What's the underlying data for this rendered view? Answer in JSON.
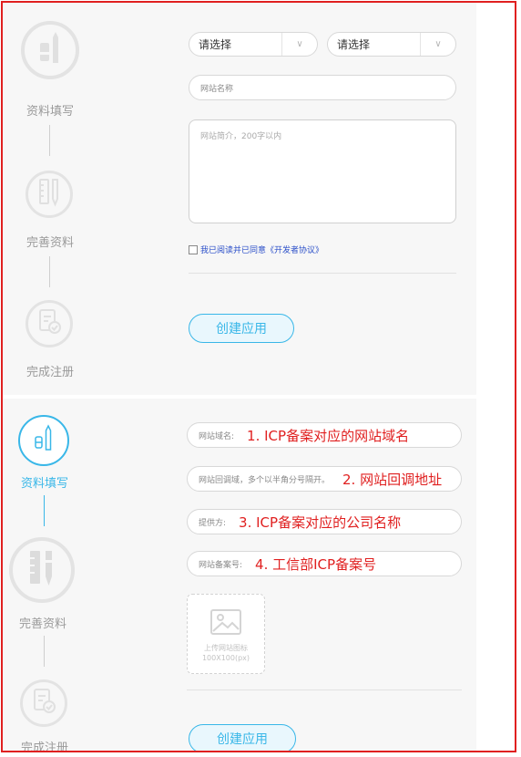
{
  "colors": {
    "accent": "#39b7e8",
    "annotation_red": "#e02020",
    "step_inactive": "#e3e3e3",
    "panel_bg": "#f7f7f7"
  },
  "top_panel": {
    "steps": [
      {
        "label": "资料填写",
        "icon": "pencil-ruler-icon"
      },
      {
        "label": "完善资料",
        "icon": "ruler-pencil-icon"
      },
      {
        "label": "完成注册",
        "icon": "document-check-icon"
      }
    ],
    "select_1": {
      "value": "请选择"
    },
    "select_2": {
      "value": "请选择"
    },
    "site_name": {
      "placeholder": "网站名称"
    },
    "site_intro": {
      "placeholder": "网站简介，200字以内"
    },
    "agree": {
      "text": "我已阅读并已同意《开发者协议》"
    },
    "create_button": "创建应用"
  },
  "bottom_panel": {
    "steps": [
      {
        "label": "资料填写",
        "icon": "pencil-ruler-icon"
      },
      {
        "label": "完善资料",
        "icon": "ruler-pencil-icon"
      },
      {
        "label": "完成注册",
        "icon": "document-check-icon"
      }
    ],
    "fields": [
      {
        "placeholder": "网站域名:",
        "annotation": "1. ICP备案对应的网站域名"
      },
      {
        "placeholder": "网站回调域，多个以半角分号隔开。",
        "annotation": "2. 网站回调地址"
      },
      {
        "placeholder": "提供方:",
        "annotation": "3. ICP备案对应的公司名称"
      },
      {
        "placeholder": "网站备案号:",
        "annotation": "4. 工信部ICP备案号"
      }
    ],
    "upload": {
      "line1": "上传网站图标",
      "line2": "100X100(px)",
      "icon": "image-icon"
    },
    "create_button": "创建应用"
  }
}
